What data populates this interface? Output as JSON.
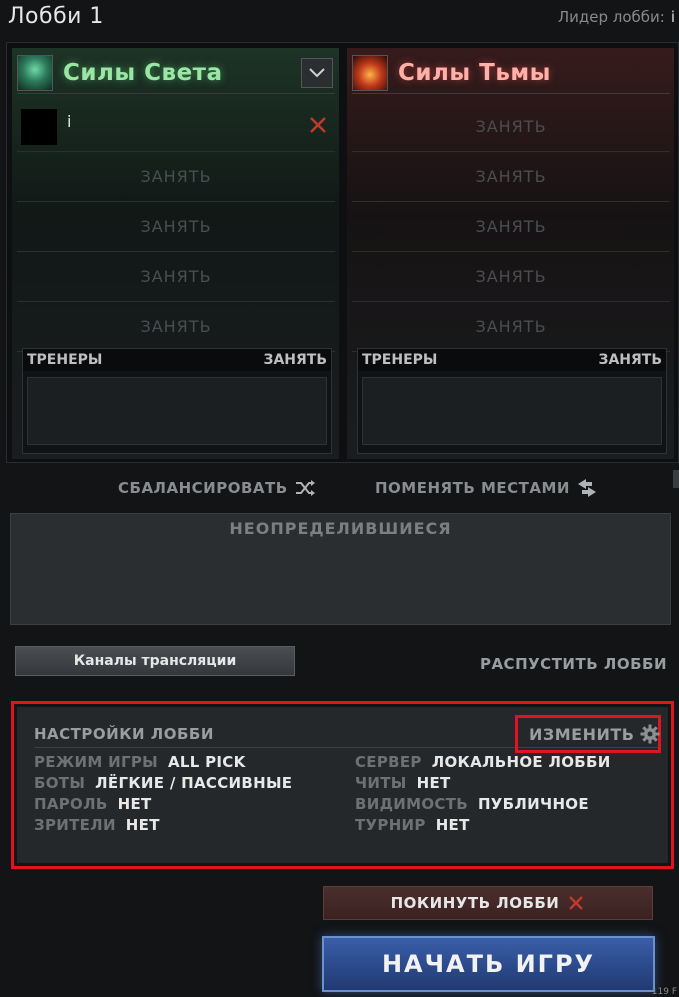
{
  "header": {
    "title": "Лобби 1",
    "leader_label": "Лидер лобби:",
    "leader_value": "i"
  },
  "teams": {
    "radiant": {
      "name": "Силы Света",
      "player_name": "i",
      "empty_slot_label": "ЗАНЯТЬ",
      "coaches_label": "ТРЕНЕРЫ",
      "coaches_join": "ЗАНЯТЬ"
    },
    "dire": {
      "name": "Силы Тьмы",
      "empty_slot_label": "ЗАНЯТЬ",
      "coaches_label": "ТРЕНЕРЫ",
      "coaches_join": "ЗАНЯТЬ"
    }
  },
  "actions": {
    "balance": "СБАЛАНСИРОВАТЬ",
    "swap": "ПОМЕНЯТЬ МЕСТАМИ",
    "unassigned_title": "НЕОПРЕДЕЛИВШИЕСЯ",
    "broadcast_channels": "Каналы трансляции",
    "disband": "РАСПУСТИТЬ ЛОББИ",
    "leave": "ПОКИНУТЬ ЛОББИ",
    "start": "НАЧАТЬ ИГРУ"
  },
  "settings": {
    "title": "НАСТРОЙКИ ЛОББИ",
    "edit": "ИЗМЕНИТЬ",
    "left": [
      {
        "key": "РЕЖИМ ИГРЫ",
        "value": "ALL PICK"
      },
      {
        "key": "БОТЫ",
        "value": "ЛЁГКИЕ / ПАССИВНЫЕ"
      },
      {
        "key": "ПАРОЛЬ",
        "value": "НЕТ"
      },
      {
        "key": "ЗРИТЕЛИ",
        "value": "НЕТ"
      }
    ],
    "right": [
      {
        "key": "СЕРВЕР",
        "value": "ЛОКАЛЬНОЕ ЛОББИ"
      },
      {
        "key": "ЧИТЫ",
        "value": "НЕТ"
      },
      {
        "key": "ВИДИМОСТЬ",
        "value": "ПУБЛИЧНОЕ"
      },
      {
        "key": "ТУРНИР",
        "value": "НЕТ"
      }
    ]
  },
  "corner_text": "119 F",
  "colors": {
    "radiant": "#9be6a4",
    "dire": "#ffb0a8",
    "highlight": "#e0141e",
    "start_button": "#2a4888"
  }
}
